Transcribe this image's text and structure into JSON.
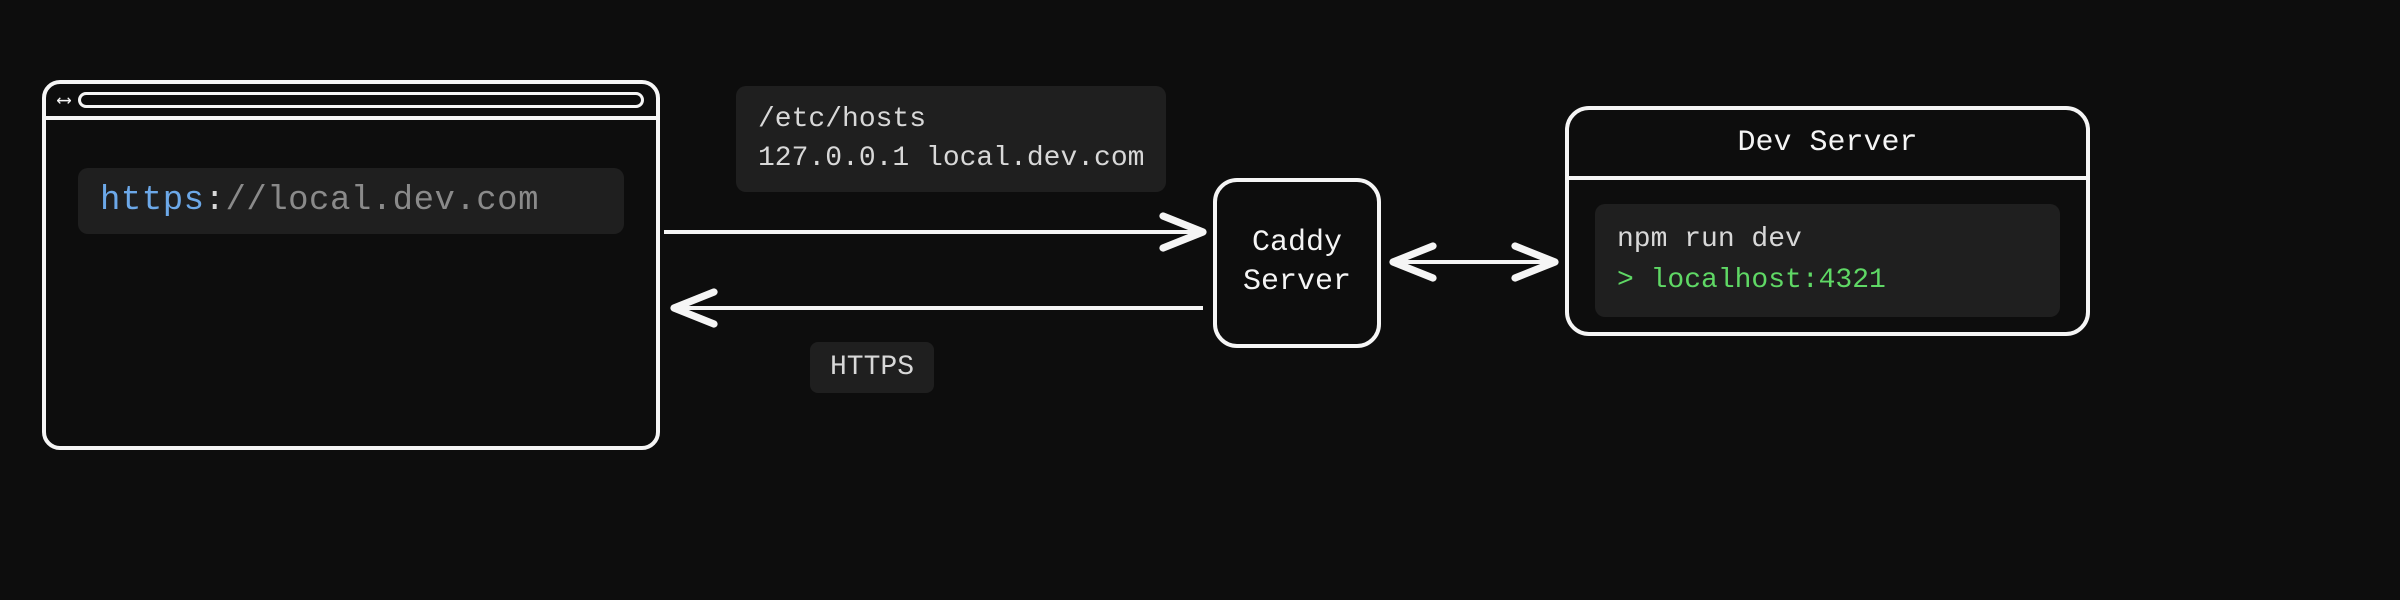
{
  "browser": {
    "url_scheme": "https",
    "url_colon": ":",
    "url_rest": "//local.dev.com"
  },
  "hosts": {
    "path": "/etc/hosts",
    "entry": "127.0.0.1 local.dev.com"
  },
  "protocol_label": "HTTPS",
  "caddy": {
    "line1": "Caddy",
    "line2": "Server"
  },
  "devserver": {
    "title": "Dev Server",
    "command": "npm run dev",
    "output": "> localhost:4321"
  }
}
